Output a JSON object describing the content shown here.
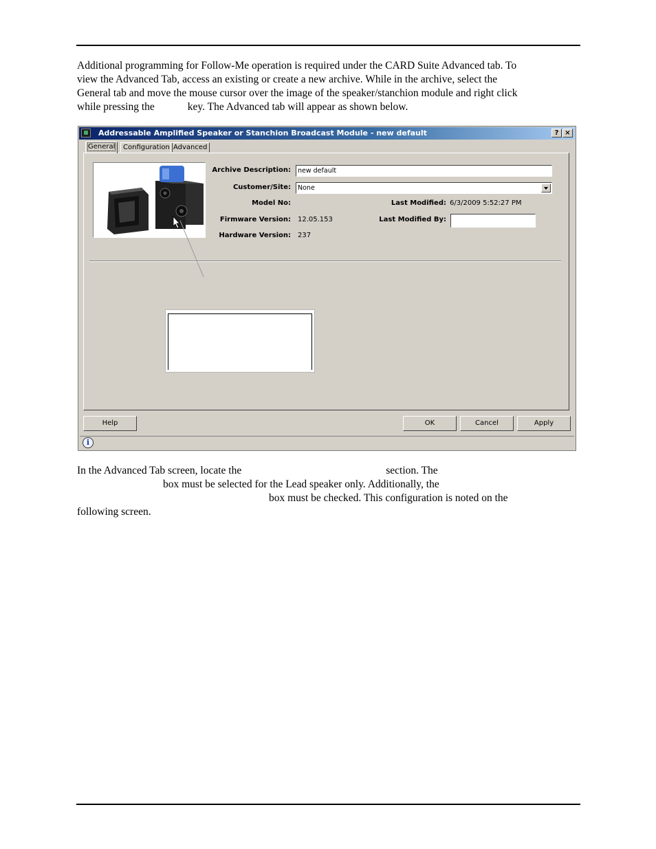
{
  "document": {
    "paragraph1": {
      "line1": "Additional programming for Follow-Me operation is required under the CARD Suite Advanced tab.  To",
      "line2": "view the Advanced Tab, access an existing or create a new archive.  While in the archive, select the",
      "line3": "General tab and move the mouse cursor over the image of the speaker/stanchion module and right click",
      "line4a": "while pressing the",
      "line4b": "key.  The Advanced tab will appear as shown below."
    },
    "paragraph2": {
      "line1a": "In the Advanced Tab screen, locate the",
      "line1b": "section.  The",
      "line2": "box must be selected for the Lead speaker only.  Additionally, the",
      "line3": "box must be checked.  This configuration is noted on the",
      "line4": "following screen."
    }
  },
  "dialog": {
    "title": "Addressable Amplified Speaker or Stanchion Broadcast Module - new default",
    "help_glyph": "?",
    "close_glyph": "×",
    "tabs": [
      "General",
      "Configuration",
      "Advanced"
    ],
    "selected_tab": "General",
    "fields": {
      "archive_description_label": "Archive Description:",
      "archive_description_value": "new default",
      "customer_site_label": "Customer/Site:",
      "customer_site_value": "None",
      "model_no_label": "Model No:",
      "model_no_value": "",
      "firmware_version_label": "Firmware Version:",
      "firmware_version_value": "12.05.153",
      "hardware_version_label": "Hardware Version:",
      "hardware_version_value": "237",
      "last_modified_label": "Last Modified:",
      "last_modified_value": "6/3/2009 5:52:27 PM",
      "last_modified_by_label": "Last Modified By:",
      "last_modified_by_value": ""
    },
    "buttons": {
      "help": "Help",
      "ok": "OK",
      "cancel": "Cancel",
      "apply": "Apply"
    },
    "status_icon": "i"
  },
  "colors": {
    "dialog_face": "#d4d0c8",
    "titlebar_start": "#0a246a",
    "titlebar_end": "#a6caf0",
    "speaker_dark": "#2a2a2a",
    "beacon_blue": "#3b6fd1"
  }
}
